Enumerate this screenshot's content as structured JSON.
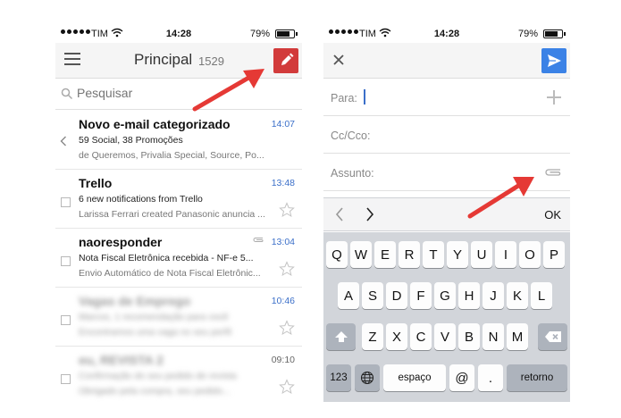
{
  "status_left": {
    "carrier": "TIM",
    "time": "14:28",
    "battery": "79%"
  },
  "status_right": {
    "carrier": "TIM",
    "time": "14:28",
    "battery": "79%"
  },
  "inbox": {
    "title": "Principal",
    "count": "1529",
    "search_placeholder": "Pesquisar",
    "messages": [
      {
        "sender": "Novo e-mail categorizado",
        "subject": "59 Social, 38 Promoções",
        "snippet": "de Queremos, Privalia Special, Source, Po...",
        "time": "14:07"
      },
      {
        "sender": "Trello",
        "subject": "6 new notifications from Trello",
        "snippet": "Larissa Ferrari created Panasonic anuncia ...",
        "time": "13:48"
      },
      {
        "sender": "naoresponder",
        "subject": "Nota Fiscal Eletrônica recebida - NF-e 5...",
        "snippet": "Envio Automático de Nota Fiscal Eletrônic...",
        "time": "13:04"
      },
      {
        "sender": "Vagas de Emprego",
        "subject": "Marcos, 1 recomendação para você",
        "snippet": "Encontramos uma vaga no seu perfil",
        "time": "10:46"
      },
      {
        "sender": "eu, REVISTA 2",
        "subject": "Confirmação do seu pedido de revista",
        "snippet": "Obrigado pela compra, seu pedido...",
        "time": "09:10"
      }
    ]
  },
  "compose": {
    "to_label": "Para:",
    "cc_label": "Cc/Cco:",
    "subject_label": "Assunto:",
    "ok_label": "OK",
    "keys_row1": [
      "Q",
      "W",
      "E",
      "R",
      "T",
      "Y",
      "U",
      "I",
      "O",
      "P"
    ],
    "keys_row2": [
      "A",
      "S",
      "D",
      "F",
      "G",
      "H",
      "J",
      "K",
      "L"
    ],
    "keys_row3": [
      "Z",
      "X",
      "C",
      "V",
      "B",
      "N",
      "M"
    ],
    "key_123": "123",
    "key_space": "espaço",
    "key_at": "@",
    "key_dot": ".",
    "key_return": "retorno"
  },
  "colors": {
    "compose_red": "#d23b3b",
    "send_blue": "#3b82e6",
    "time_blue": "#3b6fc9",
    "arrow_red": "#e53935"
  }
}
